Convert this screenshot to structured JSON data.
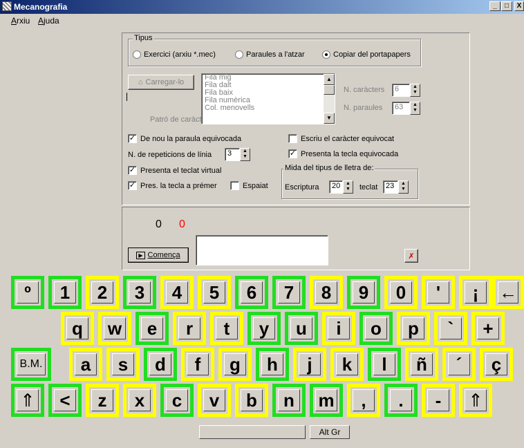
{
  "window": {
    "title": "Mecanografia",
    "minimize": "_",
    "maximize": "□",
    "close": "X"
  },
  "menu": [
    "Arxiu",
    "Ajuda"
  ],
  "tipus": {
    "label": "Tipus",
    "options": [
      {
        "label": "Exercici (arxiu *.mec)",
        "selected": false
      },
      {
        "label": "Paraules a l'atzar",
        "selected": false
      },
      {
        "label": "Copiar del portapapers",
        "selected": true
      }
    ]
  },
  "load_button": "Carregar-lo",
  "pattern_label": "Patró de caràcters",
  "pattern_list": [
    "Fila mig",
    "Fila dalt",
    "Fila baix",
    "Fila numèrica",
    "Col. menovells"
  ],
  "n_chars": {
    "label": "N. caràcters",
    "value": "6"
  },
  "n_words": {
    "label": "N. paraules",
    "value": "63"
  },
  "options": {
    "repeat_wrong_word": {
      "label": "De nou la paraula equivocada",
      "checked": true
    },
    "line_repeats": {
      "label": "N. de repeticions de línia",
      "value": "3"
    },
    "show_keyboard": {
      "label": "Presenta el teclat virtual",
      "checked": true
    },
    "show_key_to_press": {
      "label": "Pres. la tecla a prémer",
      "checked": true
    },
    "spaced": {
      "label": "Espaiat",
      "checked": false
    },
    "write_wrong_char": {
      "label": "Escriu el caràcter equivocat",
      "checked": false
    },
    "show_wrong_key": {
      "label": "Presenta la tecla equivocada",
      "checked": true
    }
  },
  "font_size": {
    "label": "Mida del tipus de lletra de:",
    "writing_label": "Escriptura",
    "writing_value": "20",
    "keyboard_label": "teclat",
    "keyboard_value": "23"
  },
  "counters": {
    "correct": "0",
    "wrong": "0",
    "wrong_color": "#ff0000"
  },
  "start_button": "Comença",
  "input_text": "",
  "keyboard": {
    "row1": [
      "º",
      "1",
      "2",
      "3",
      "4",
      "5",
      "6",
      "7",
      "8",
      "9",
      "0",
      "'",
      "¡",
      "←"
    ],
    "row2": [
      "q",
      "w",
      "e",
      "r",
      "t",
      "y",
      "u",
      "i",
      "o",
      "p",
      "`",
      "+"
    ],
    "row3": [
      "B.M.",
      "a",
      "s",
      "d",
      "f",
      "g",
      "h",
      "j",
      "k",
      "l",
      "ñ",
      "´",
      "ç"
    ],
    "row4": [
      "⇑",
      "<",
      "z",
      "x",
      "c",
      "v",
      "b",
      "n",
      "m",
      ",",
      ".",
      "-",
      "⇑"
    ],
    "space": "",
    "altgr": "Alt Gr",
    "colors": {
      "green": "#22dd22",
      "yellow": "#ffff00"
    }
  }
}
